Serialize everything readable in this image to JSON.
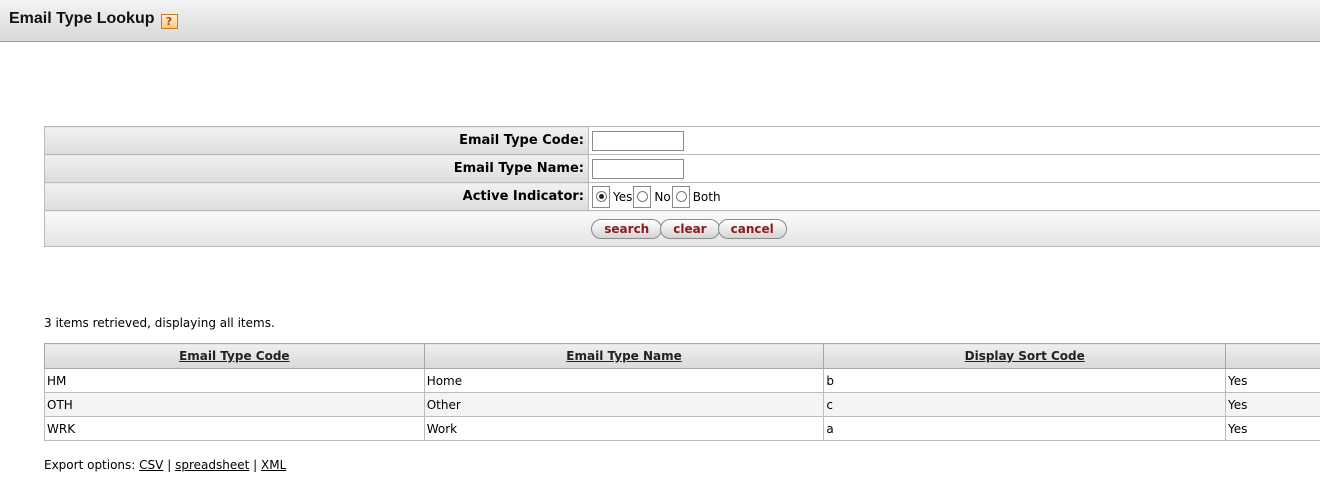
{
  "page": {
    "title": "Email Type Lookup",
    "help_glyph": "?"
  },
  "search_form": {
    "fields": [
      {
        "label": "Email Type Code:",
        "value": ""
      },
      {
        "label": "Email Type Name:",
        "value": ""
      }
    ],
    "active_indicator": {
      "label": "Active Indicator:",
      "options": [
        "Yes",
        "No",
        "Both"
      ],
      "selected": "Yes"
    },
    "buttons": {
      "search": "search",
      "clear": "clear",
      "cancel": "cancel"
    }
  },
  "results": {
    "status": "3 items retrieved, displaying all items.",
    "columns": [
      "Email Type Code",
      "Email Type Name",
      "Display Sort Code",
      ""
    ],
    "rows": [
      [
        "HM",
        "Home",
        "b",
        "Yes"
      ],
      [
        "OTH",
        "Other",
        "c",
        "Yes"
      ],
      [
        "WRK",
        "Work",
        "a",
        "Yes"
      ]
    ]
  },
  "export": {
    "label": "Export options:",
    "options": [
      "CSV",
      "spreadsheet",
      "XML"
    ],
    "separator": "|"
  },
  "colors": {
    "button_text": "#8b1b1b",
    "help_icon": "#b1451b"
  }
}
